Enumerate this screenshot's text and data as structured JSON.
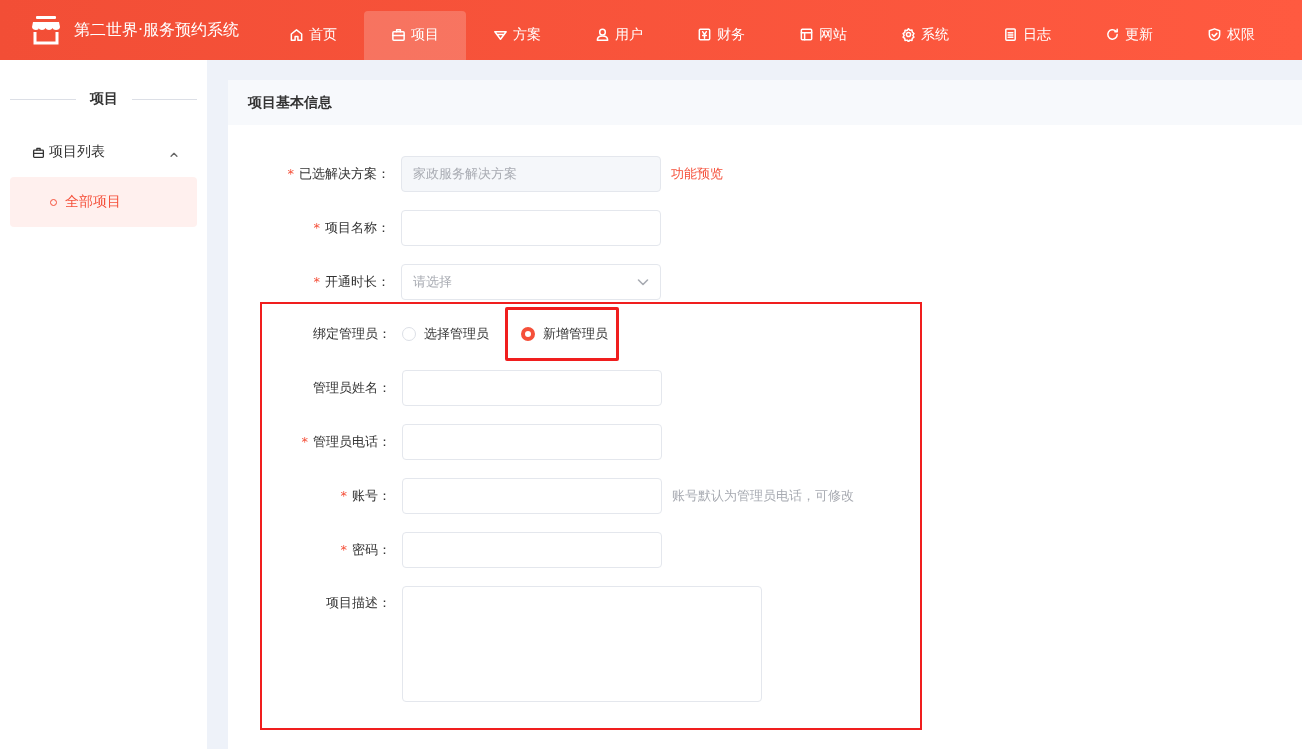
{
  "header": {
    "app_title": "第二世界·服务预约系统",
    "nav": [
      {
        "label": "首页",
        "selected": false
      },
      {
        "label": "项目",
        "selected": true
      },
      {
        "label": "方案",
        "selected": false
      },
      {
        "label": "用户",
        "selected": false
      },
      {
        "label": "财务",
        "selected": false
      },
      {
        "label": "网站",
        "selected": false
      },
      {
        "label": "系统",
        "selected": false
      },
      {
        "label": "日志",
        "selected": false
      },
      {
        "label": "更新",
        "selected": false
      },
      {
        "label": "权限",
        "selected": false
      }
    ]
  },
  "sidebar": {
    "title": "项目",
    "groups": [
      {
        "label": "项目列表",
        "expanded": true,
        "items": [
          {
            "label": "全部项目",
            "selected": true
          }
        ]
      }
    ]
  },
  "card": {
    "title": "项目基本信息",
    "fields": [
      {
        "kind": "input",
        "required_mark": "*",
        "label": "已选解决方案：",
        "disabled": true,
        "value": "家政服务解决方案",
        "link": "功能预览"
      },
      {
        "kind": "input",
        "required_mark": "*",
        "label": "项目名称："
      },
      {
        "kind": "select",
        "required_mark": "*",
        "label": "开通时长：",
        "placeholder": "请选择"
      }
    ],
    "admin_section": {
      "highlighted": true,
      "fields": [
        {
          "kind": "radio",
          "label": "绑定管理员：",
          "options": [
            {
              "label": "选择管理员",
              "selected": false,
              "highlighted": false
            },
            {
              "label": "新增管理员",
              "selected": true,
              "highlighted": true
            }
          ]
        },
        {
          "kind": "input",
          "label": "管理员姓名："
        },
        {
          "kind": "input",
          "required_mark": "*",
          "label": "管理员电话："
        },
        {
          "kind": "input",
          "required_mark": "*",
          "label": "账号：",
          "note": "账号默认为管理员电话，可修改"
        },
        {
          "kind": "input",
          "required_mark": "*",
          "label": "密码："
        },
        {
          "kind": "textarea",
          "label": "项目描述："
        }
      ]
    }
  }
}
